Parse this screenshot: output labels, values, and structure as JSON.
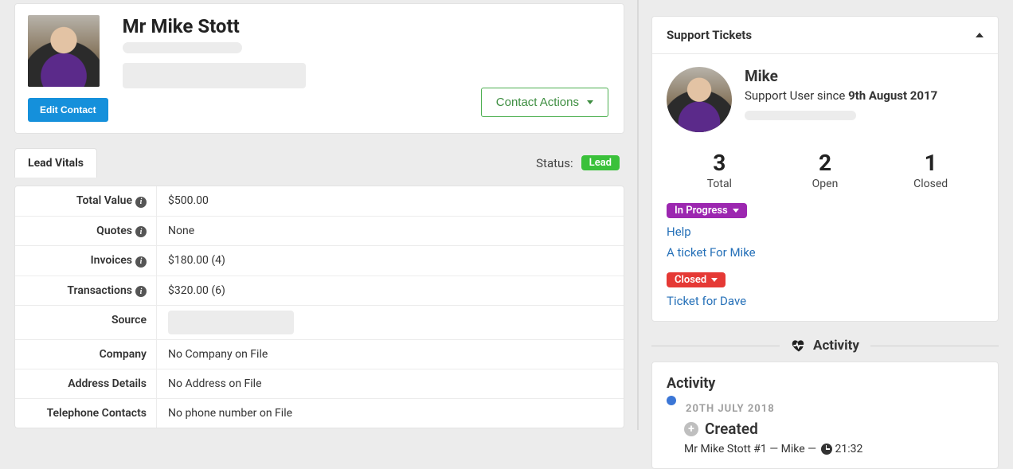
{
  "contact": {
    "name": "Mr Mike Stott",
    "edit_button": "Edit Contact",
    "actions_button": "Contact Actions"
  },
  "tabs": {
    "lead_vitals": "Lead Vitals",
    "status_label": "Status:",
    "status_badge": "Lead"
  },
  "vitals": {
    "total_value": {
      "label": "Total Value",
      "value": "$500.00"
    },
    "quotes": {
      "label": "Quotes",
      "value": "None"
    },
    "invoices": {
      "label": "Invoices",
      "value": "$180.00 (4)"
    },
    "transactions": {
      "label": "Transactions",
      "value": "$320.00 (6)"
    },
    "source": {
      "label": "Source"
    },
    "company": {
      "label": "Company",
      "value": "No Company on File"
    },
    "address": {
      "label": "Address Details",
      "value": "No Address on File"
    },
    "telephone": {
      "label": "Telephone Contacts",
      "value": "No phone number on File"
    }
  },
  "support": {
    "header": "Support Tickets",
    "name": "Mike",
    "since_prefix": "Support User since ",
    "since_date": "9th August 2017",
    "stats": {
      "total": {
        "num": "3",
        "label": "Total"
      },
      "open": {
        "num": "2",
        "label": "Open"
      },
      "closed": {
        "num": "1",
        "label": "Closed"
      }
    },
    "in_progress_badge": "In Progress",
    "tickets_open": [
      "Help",
      "A ticket For Mike"
    ],
    "closed_badge": "Closed",
    "tickets_closed": [
      "Ticket for Dave"
    ]
  },
  "activity_section_label": "Activity",
  "activity": {
    "header": "Activity",
    "date": "20TH JULY 2018",
    "event_title": "Created",
    "event_meta_prefix": "Mr Mike Stott #1 — Mike — ",
    "event_time": "21:32"
  }
}
